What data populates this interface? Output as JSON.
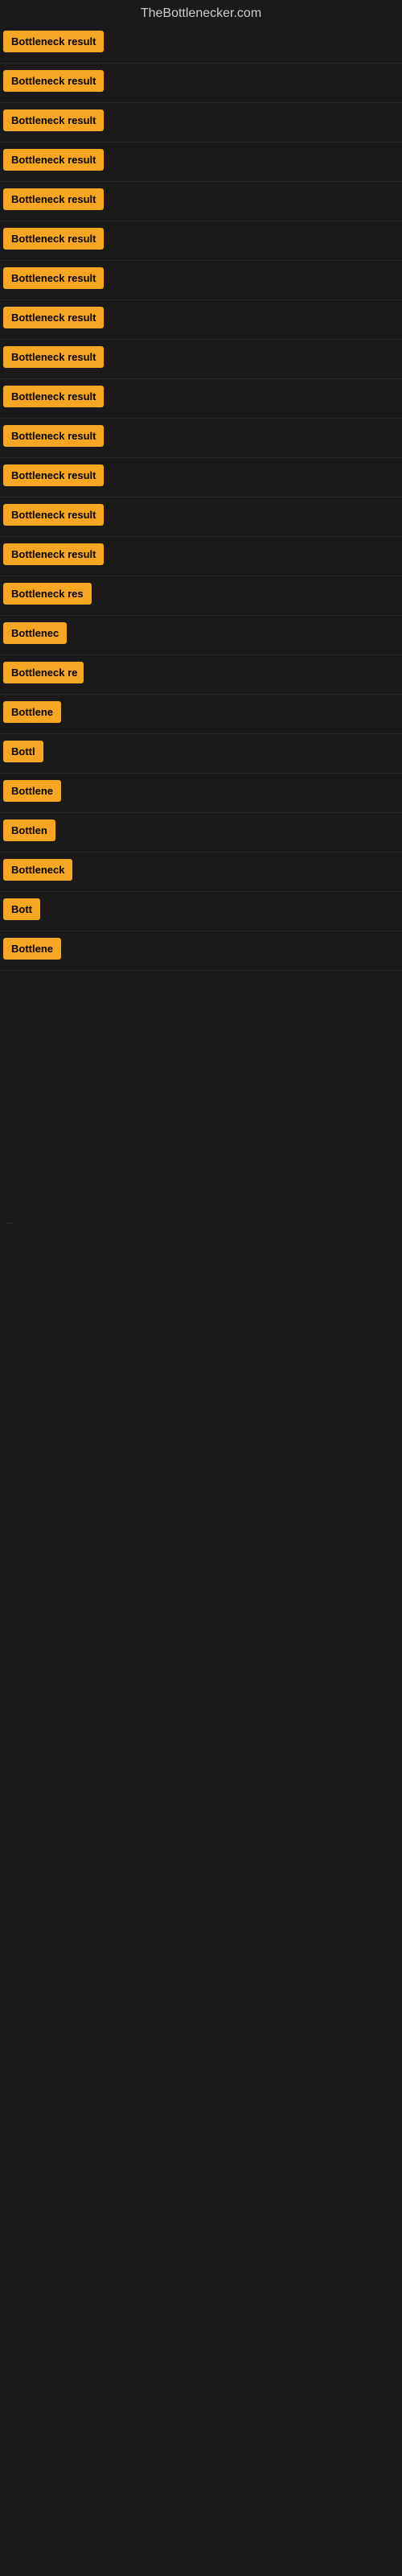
{
  "site": {
    "title": "TheBottlenecker.com"
  },
  "rows": [
    {
      "id": 1,
      "label": "Bottleneck result",
      "width": 130
    },
    {
      "id": 2,
      "label": "Bottleneck result",
      "width": 130
    },
    {
      "id": 3,
      "label": "Bottleneck result",
      "width": 130
    },
    {
      "id": 4,
      "label": "Bottleneck result",
      "width": 130
    },
    {
      "id": 5,
      "label": "Bottleneck result",
      "width": 130
    },
    {
      "id": 6,
      "label": "Bottleneck result",
      "width": 130
    },
    {
      "id": 7,
      "label": "Bottleneck result",
      "width": 130
    },
    {
      "id": 8,
      "label": "Bottleneck result",
      "width": 130
    },
    {
      "id": 9,
      "label": "Bottleneck result",
      "width": 130
    },
    {
      "id": 10,
      "label": "Bottleneck result",
      "width": 130
    },
    {
      "id": 11,
      "label": "Bottleneck result",
      "width": 130
    },
    {
      "id": 12,
      "label": "Bottleneck result",
      "width": 130
    },
    {
      "id": 13,
      "label": "Bottleneck result",
      "width": 130
    },
    {
      "id": 14,
      "label": "Bottleneck result",
      "width": 130
    },
    {
      "id": 15,
      "label": "Bottleneck res",
      "width": 110
    },
    {
      "id": 16,
      "label": "Bottlenec",
      "width": 80
    },
    {
      "id": 17,
      "label": "Bottleneck re",
      "width": 100
    },
    {
      "id": 18,
      "label": "Bottlene",
      "width": 75
    },
    {
      "id": 19,
      "label": "Bottl",
      "width": 55
    },
    {
      "id": 20,
      "label": "Bottlene",
      "width": 75
    },
    {
      "id": 21,
      "label": "Bottlen",
      "width": 68
    },
    {
      "id": 22,
      "label": "Bottleneck",
      "width": 88
    },
    {
      "id": 23,
      "label": "Bott",
      "width": 48
    },
    {
      "id": 24,
      "label": "Bottlene",
      "width": 75
    }
  ],
  "footer_text": "..."
}
